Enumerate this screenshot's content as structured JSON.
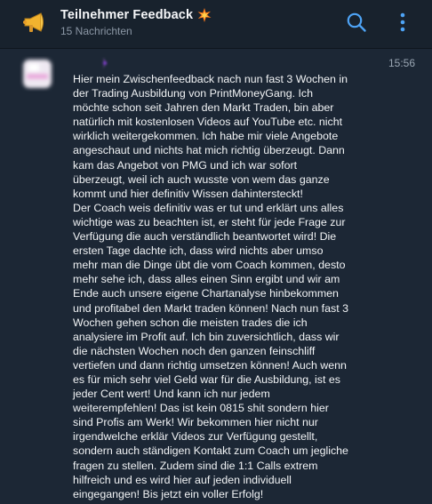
{
  "header": {
    "channel_icon": "megaphone-icon",
    "title": "Teilnehmer Feedback",
    "title_emoji": "spark-emoji-icon",
    "subtitle": "15 Nachrichten",
    "search_icon": "search-icon",
    "more_icon": "more-vertical-icon"
  },
  "message": {
    "avatar": "blurred-avatar",
    "time": "15:56",
    "text": "Hier mein Zwischenfeedback nach nun fast 3 Wochen in\nder Trading Ausbildung von PrintMoneyGang. Ich\nmöchte schon seit Jahren den Markt Traden, bin aber\nnatürlich mit kostenlosen Videos auf YouTube etc. nicht\nwirklich weitergekommen. Ich habe mir viele Angebote\nangeschaut und nichts hat mich richtig überzeugt. Dann\nkam das Angebot von PMG und ich war sofort\nüberzeugt, weil ich auch wusste von wem das ganze\nkommt und hier definitiv Wissen dahintersteckt!\nDer Coach weis definitiv was er tut und erklärt uns alles\nwichtige was zu beachten ist, er steht für jede Frage zur\nVerfügung die auch verständlich beantwortet wird! Die\nersten Tage dachte ich, dass wird nichts aber umso\nmehr man die Dinge übt die vom Coach kommen, desto\nmehr sehe ich, dass alles einen Sinn ergibt und wir am\nEnde auch unsere eigene Chartanalyse hinbekommen\nund profitabel den Markt traden können! Nach nun fast 3\nWochen gehen schon die meisten trades die ich\nanalysiere im Profit auf. Ich bin zuversichtlich, dass wir\ndie nächsten Wochen noch den ganzen feinschliff\nvertiefen und dann richtig umsetzen können! Auch wenn\nes für mich sehr viel Geld war für die Ausbildung, ist es\njeder Cent wert! Und kann ich nur jedem\nweiterempfehlen! Das ist kein 0815 shit sondern hier\nsind Profis am Werk! Wir bekommen hier nicht nur\nirgendwelche erklär Videos zur Verfügung gestellt,\nsondern auch ständigen Kontakt zum Coach um jegliche\nfragen zu stellen. Zudem sind die 1:1 Calls extrem\nhilfreich und es wird hier auf jeden individuell\neingegangen! Bis jetzt ein voller Erfolg!"
  },
  "colors": {
    "background": "#1c2735",
    "header_background": "#18222d",
    "accent": "#4ea4f6",
    "text_primary": "#f1f3f5",
    "text_secondary": "#8b97a5"
  }
}
